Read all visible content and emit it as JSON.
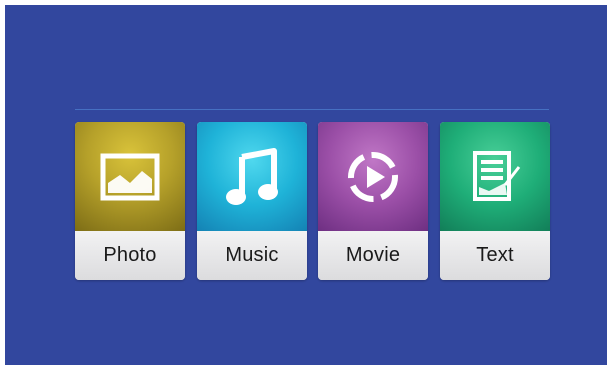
{
  "menu": {
    "tiles": [
      {
        "id": "photo",
        "label": "Photo",
        "icon": "photo-icon",
        "color": "#b6a12a"
      },
      {
        "id": "music",
        "label": "Music",
        "icon": "music-note-icon",
        "color": "#1fb3d8"
      },
      {
        "id": "movie",
        "label": "Movie",
        "icon": "play-circle-icon",
        "color": "#9b4fa7"
      },
      {
        "id": "text",
        "label": "Text",
        "icon": "document-edit-icon",
        "color": "#1fae78"
      }
    ]
  },
  "colors": {
    "background": "#32479e",
    "divider": "#4a78c8"
  }
}
